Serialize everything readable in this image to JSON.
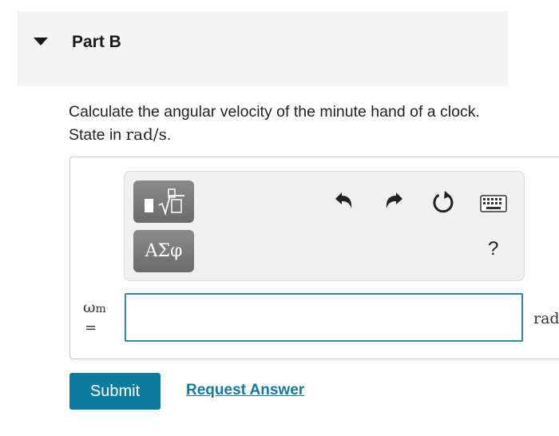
{
  "part": {
    "title": "Part B"
  },
  "question": {
    "text": "Calculate the angular velocity of the minute hand of a clock. State in ",
    "unit_math": "rad/s",
    "suffix": "."
  },
  "toolbar": {
    "templates_icon": "square-root-template-icon",
    "symbols_label": "ΑΣφ",
    "undo_icon": "undo-arrow-icon",
    "redo_icon": "redo-arrow-icon",
    "reset_icon": "reset-icon",
    "keyboard_icon": "keyboard-icon",
    "help_label": "?"
  },
  "answer": {
    "variable": "ω",
    "variable_sub": "m",
    "equals": "=",
    "value": "",
    "unit_label": "rad/s"
  },
  "actions": {
    "submit_label": "Submit",
    "request_label": "Request Answer"
  },
  "colors": {
    "submit_bg": "#0e7c9f",
    "link": "#147a9e",
    "input_border": "#2c8ba8",
    "header_bg": "#f5f5f5"
  }
}
